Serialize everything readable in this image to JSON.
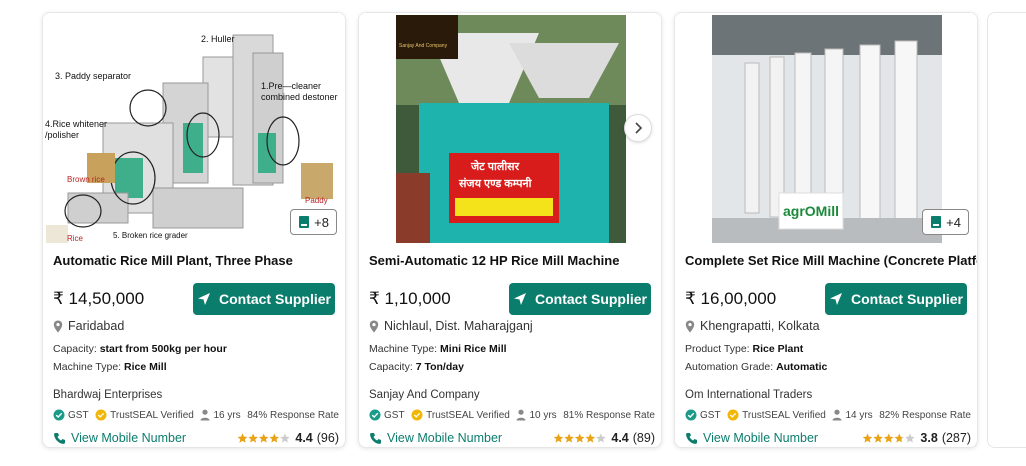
{
  "cards": [
    {
      "title": "Automatic Rice Mill Plant, Three Phase",
      "price": "₹ 14,50,000",
      "contact_label": "Contact Supplier",
      "location": "Faridabad",
      "specs": [
        {
          "label": "Capacity:",
          "value": "start from 500kg per hour"
        },
        {
          "label": "Machine Type:",
          "value": "Rice Mill"
        }
      ],
      "supplier": "Bhardwaj Enterprises",
      "gst": "GST",
      "trustseal": "TrustSEAL Verified",
      "years": "16 yrs",
      "response": "84% Response Rate",
      "view_mobile": "View Mobile Number",
      "rating": "4.4",
      "reviews": "(96)",
      "more_images": "+8",
      "image_labels": {
        "huller": "2. Huller",
        "paddy_separator": "3. Paddy separator",
        "precleaner": "1.Pre—cleaner combined destoner",
        "whitener": "4.Rice whitener /polisher",
        "brown_rice": "Brown rice",
        "paddy": "Paddy",
        "rice": "Rice",
        "grader": "5. Broken rice grader"
      }
    },
    {
      "title": "Semi-Automatic 12 HP Rice Mill Machine",
      "price": "₹ 1,10,000",
      "contact_label": "Contact Supplier",
      "location": "Nichlaul, Dist. Maharajganj",
      "specs": [
        {
          "label": "Machine Type:",
          "value": "Mini Rice Mill"
        },
        {
          "label": "Capacity:",
          "value": "7 Ton/day"
        }
      ],
      "supplier": "Sanjay And Company",
      "gst": "GST",
      "trustseal": "TrustSEAL Verified",
      "years": "10 yrs",
      "response": "81% Response Rate",
      "view_mobile": "View Mobile Number",
      "rating": "4.4",
      "reviews": "(89)",
      "image_labels": {
        "logo_text": "Sanjay And Company",
        "sign_line1": "जेट पालीसर",
        "sign_line2": "संजय एण्ड कम्पनी"
      }
    },
    {
      "title": "Complete Set Rice Mill Machine (Concrete Platform)",
      "price": "₹ 16,00,000",
      "contact_label": "Contact Supplier",
      "location": "Khengrapatti, Kolkata",
      "specs": [
        {
          "label": "Product Type:",
          "value": "Rice Plant"
        },
        {
          "label": "Automation Grade:",
          "value": "Automatic"
        }
      ],
      "supplier": "Om International Traders",
      "gst": "GST",
      "trustseal": "TrustSEAL Verified",
      "years": "14 yrs",
      "response": "82% Response Rate",
      "view_mobile": "View Mobile Number",
      "rating": "3.8",
      "reviews": "(287)",
      "more_images": "+4",
      "image_labels": {
        "logo": "agrOMill"
      }
    }
  ],
  "colors": {
    "accent": "#0b7d6d",
    "star": "#e8a317",
    "gst_check": "#1a9b8a",
    "seal": "#f2b705"
  },
  "icons": {
    "contact": "send-icon",
    "location": "location-pin-icon",
    "gst": "verified-check-icon",
    "seal": "trustseal-icon",
    "years": "person-icon",
    "phone": "phone-icon",
    "gallery": "gallery-icon",
    "next": "chevron-right-icon"
  }
}
